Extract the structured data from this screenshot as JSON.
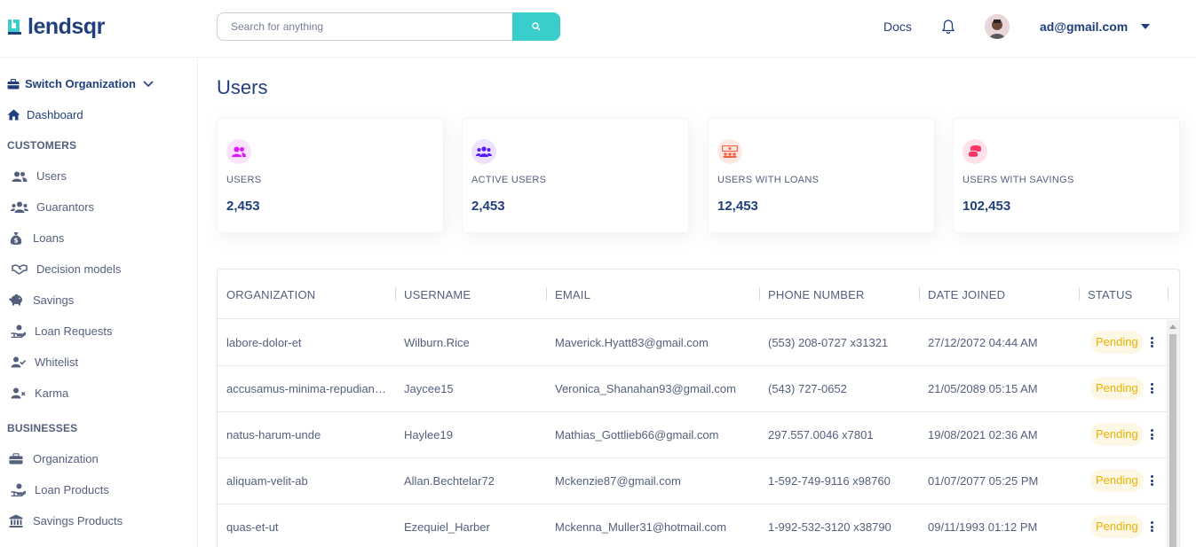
{
  "brand": {
    "name": "lendsqr",
    "color": "#213F7D",
    "accent": "#39CDCC"
  },
  "topbar": {
    "search_placeholder": "Search for anything",
    "docs_label": "Docs",
    "user_email": "ad@gmail.com"
  },
  "sidebar": {
    "switch_org": "Switch Organization",
    "dashboard": "Dashboard",
    "sections": [
      {
        "title": "CUSTOMERS",
        "items": [
          "Users",
          "Guarantors",
          "Loans",
          "Decision models",
          "Savings",
          "Loan Requests",
          "Whitelist",
          "Karma"
        ]
      },
      {
        "title": "BUSINESSES",
        "items": [
          "Organization",
          "Loan Products",
          "Savings Products"
        ]
      }
    ]
  },
  "main": {
    "title": "Users",
    "cards": [
      {
        "label": "USERS",
        "value": "2,453",
        "icon": "users-icon",
        "color": "#DF18FF"
      },
      {
        "label": "ACTIVE USERS",
        "value": "2,453",
        "icon": "active-users-icon",
        "color": "#5718FF"
      },
      {
        "label": "USERS WITH LOANS",
        "value": "12,453",
        "icon": "loans-icon",
        "color": "#F55F44"
      },
      {
        "label": "USERS WITH SAVINGS",
        "value": "102,453",
        "icon": "savings-icon",
        "color": "#FF3366"
      }
    ]
  },
  "table": {
    "columns": [
      "ORGANIZATION",
      "USERNAME",
      "EMAIL",
      "PHONE NUMBER",
      "DATE JOINED",
      "STATUS"
    ],
    "rows": [
      [
        "labore-dolor-et",
        "Wilburn.Rice",
        "Maverick.Hyatt83@gmail.com",
        "(553) 208-0727 x31321",
        "27/12/2072 04:44 AM",
        "Pending"
      ],
      [
        "accusamus-minima-repudiandae",
        "Jaycee15",
        "Veronica_Shanahan93@gmail.com",
        "(543) 727-0652",
        "21/05/2089 05:15 AM",
        "Pending"
      ],
      [
        "natus-harum-unde",
        "Haylee19",
        "Mathias_Gottlieb66@gmail.com",
        "297.557.0046 x7801",
        "19/08/2021 02:36 AM",
        "Pending"
      ],
      [
        "aliquam-velit-ab",
        "Allan.Bechtelar72",
        "Mckenzie87@gmail.com",
        "1-592-749-9116 x98760",
        "01/07/2077 05:25 PM",
        "Pending"
      ],
      [
        "quas-et-ut",
        "Ezequiel_Harber",
        "Mckenna_Muller31@hotmail.com",
        "1-992-532-3120 x38790",
        "09/11/1993 01:12 PM",
        "Pending"
      ]
    ],
    "status_colors": {
      "Pending": "#E9B200"
    }
  }
}
